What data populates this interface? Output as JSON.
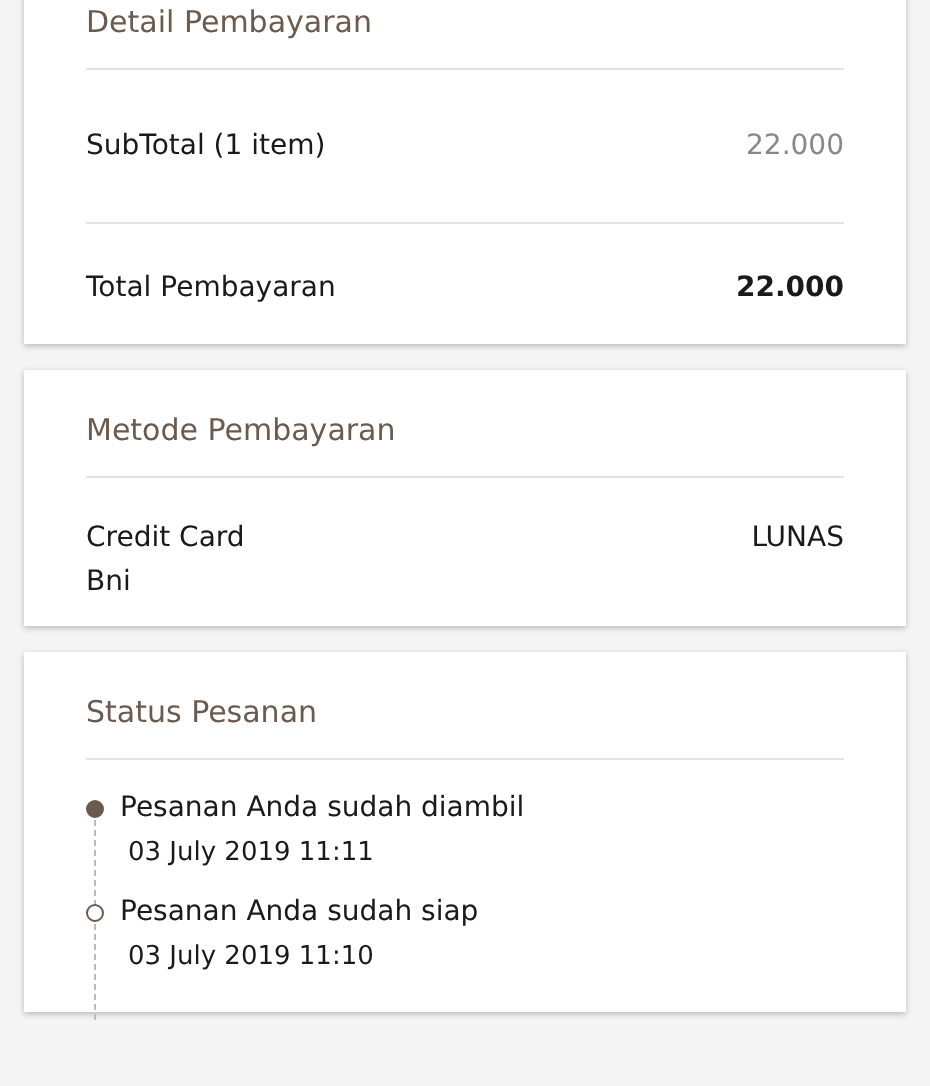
{
  "payment_detail": {
    "title": "Detail Pembayaran",
    "rows": [
      {
        "kind": "subtotal",
        "label": "SubTotal (1 item)",
        "value": "22.000"
      },
      {
        "kind": "total",
        "label": "Total Pembayaran",
        "value": "22.000"
      }
    ]
  },
  "payment_method": {
    "title": "Metode Pembayaran",
    "method": "Credit Card",
    "bank": "Bni",
    "status": "LUNAS"
  },
  "order_status": {
    "title": "Status Pesanan",
    "events": [
      {
        "text": "Pesanan Anda sudah diambil",
        "time": "03 July 2019 11:11",
        "active": true
      },
      {
        "text": "Pesanan Anda sudah siap",
        "time": "03 July 2019 11:10",
        "active": false
      }
    ]
  }
}
